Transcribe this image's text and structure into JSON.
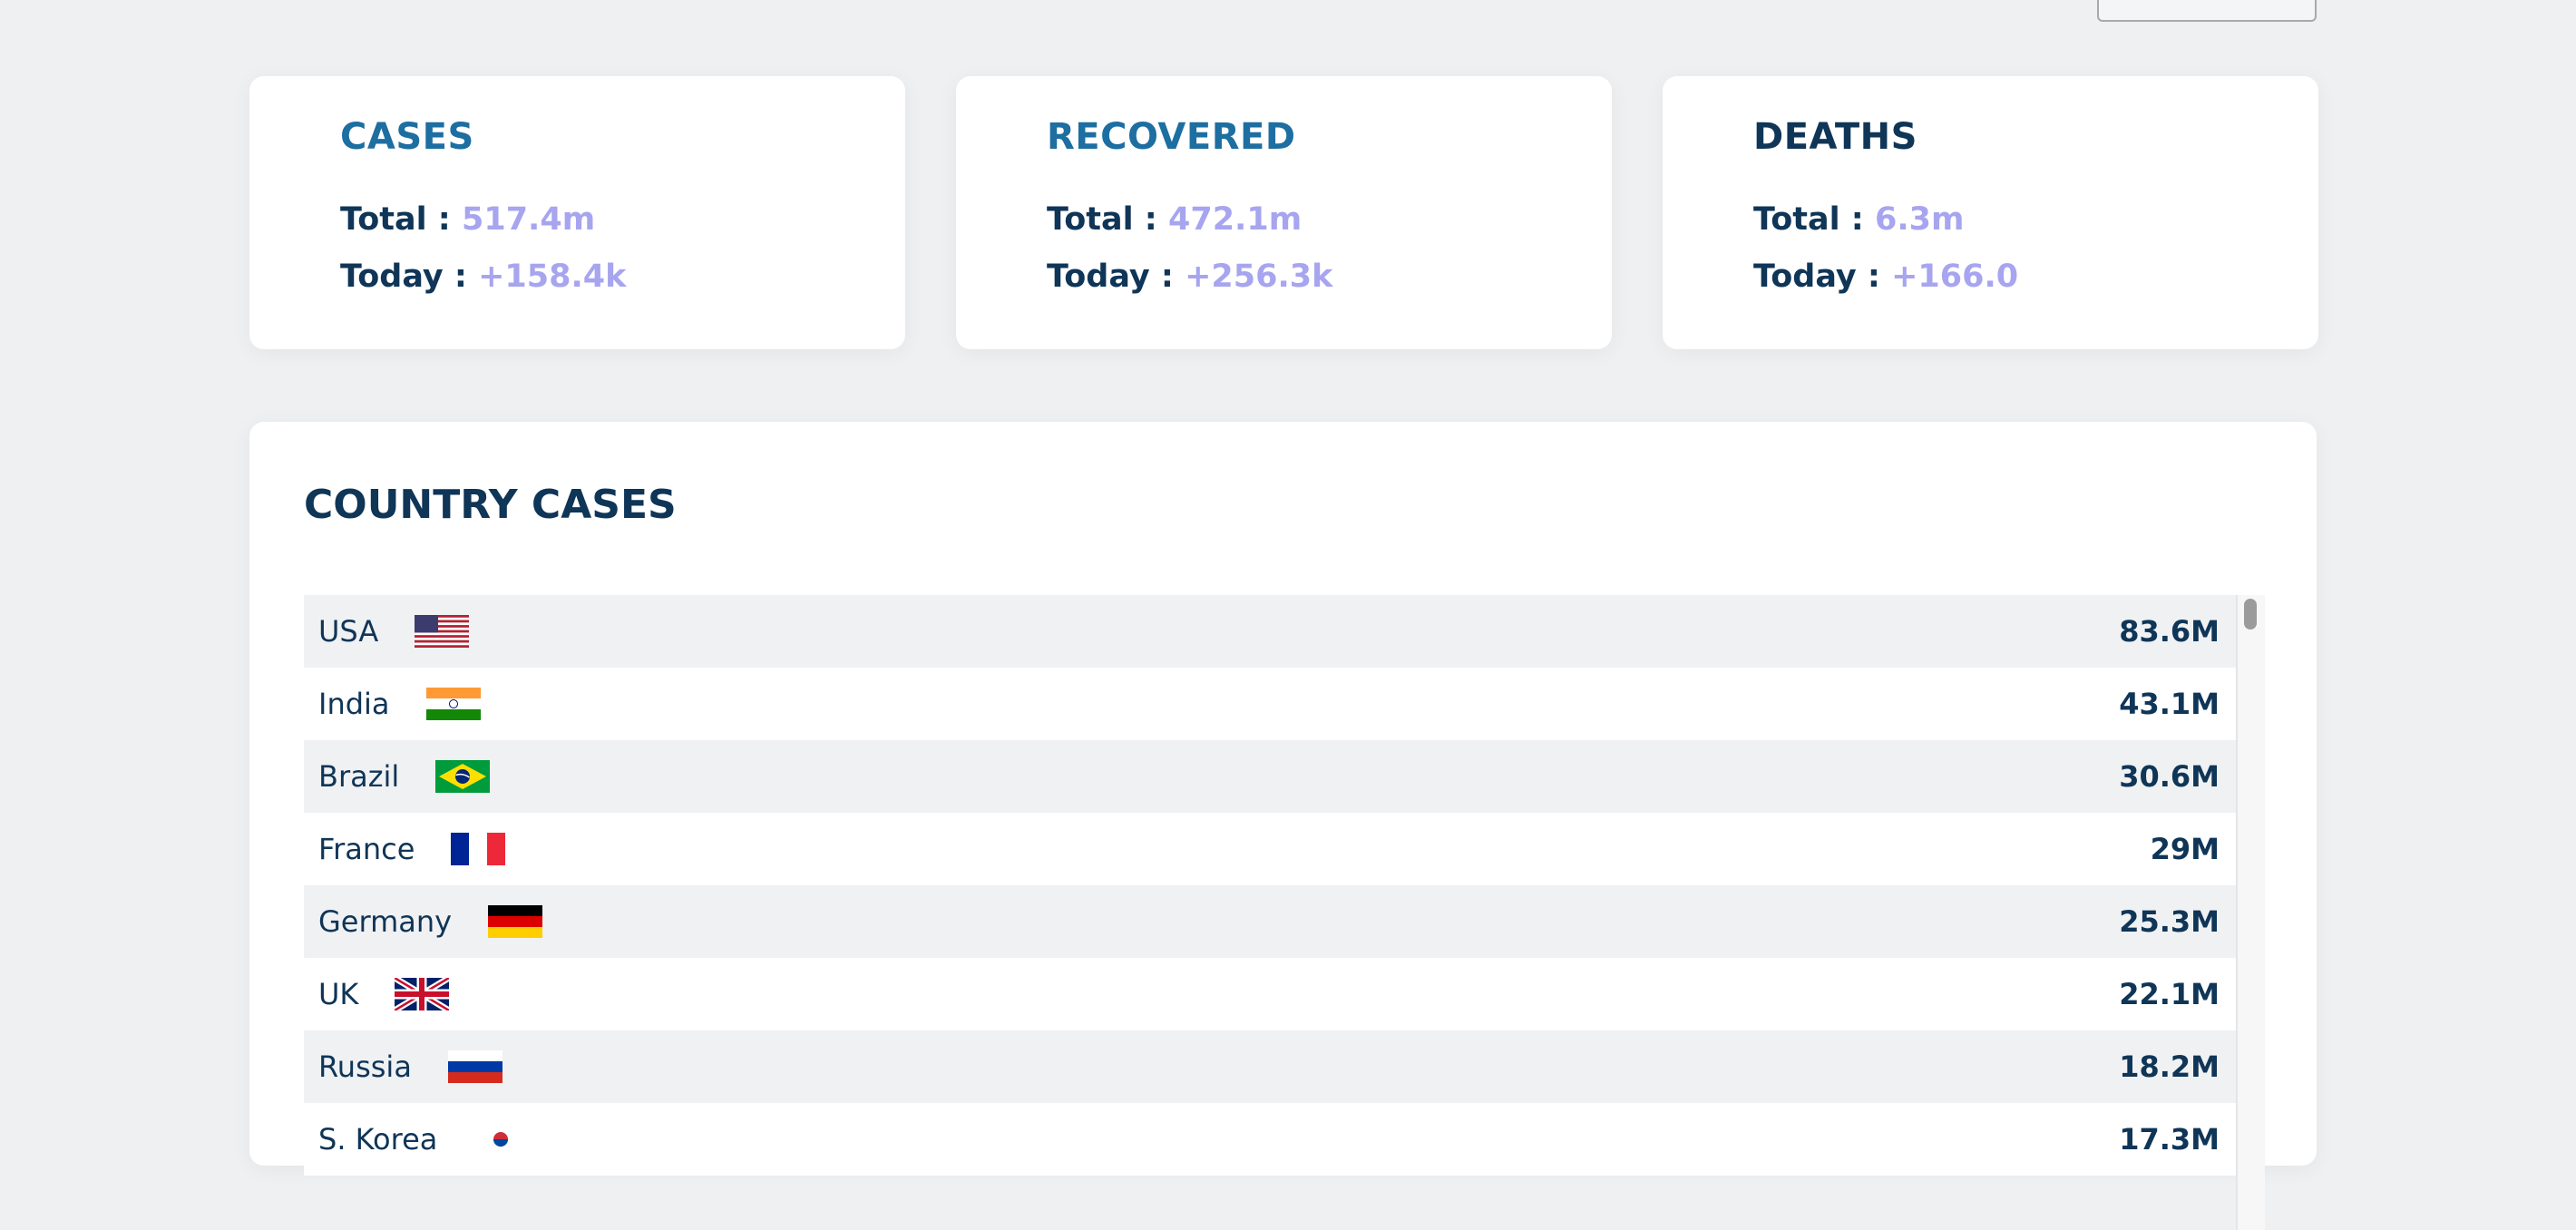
{
  "stats": {
    "total_label": "Total :",
    "today_label": "Today :",
    "cases": {
      "title": "CASES",
      "total": "517.4m",
      "today": "+158.4k"
    },
    "recovered": {
      "title": "RECOVERED",
      "total": "472.1m",
      "today": "+256.3k"
    },
    "deaths": {
      "title": "DEATHS",
      "total": "6.3m",
      "today": "+166.0"
    }
  },
  "country_cases": {
    "title": "COUNTRY CASES",
    "rows": [
      {
        "name": "USA",
        "count": "83.6M",
        "flag": "usa-flag-icon"
      },
      {
        "name": "India",
        "count": "43.1M",
        "flag": "india-flag-icon"
      },
      {
        "name": "Brazil",
        "count": "30.6M",
        "flag": "brazil-flag-icon"
      },
      {
        "name": "France",
        "count": "29M",
        "flag": "france-flag-icon"
      },
      {
        "name": "Germany",
        "count": "25.3M",
        "flag": "germany-flag-icon"
      },
      {
        "name": "UK",
        "count": "22.1M",
        "flag": "uk-flag-icon"
      },
      {
        "name": "Russia",
        "count": "18.2M",
        "flag": "russia-flag-icon"
      },
      {
        "name": "S. Korea",
        "count": "17.3M",
        "flag": "south-korea-flag-icon"
      }
    ]
  },
  "colors": {
    "background": "#eff0f2",
    "accent_title": "#1d6ea1",
    "text_dark": "#0f3557",
    "value_purple": "#a7a5ef"
  }
}
